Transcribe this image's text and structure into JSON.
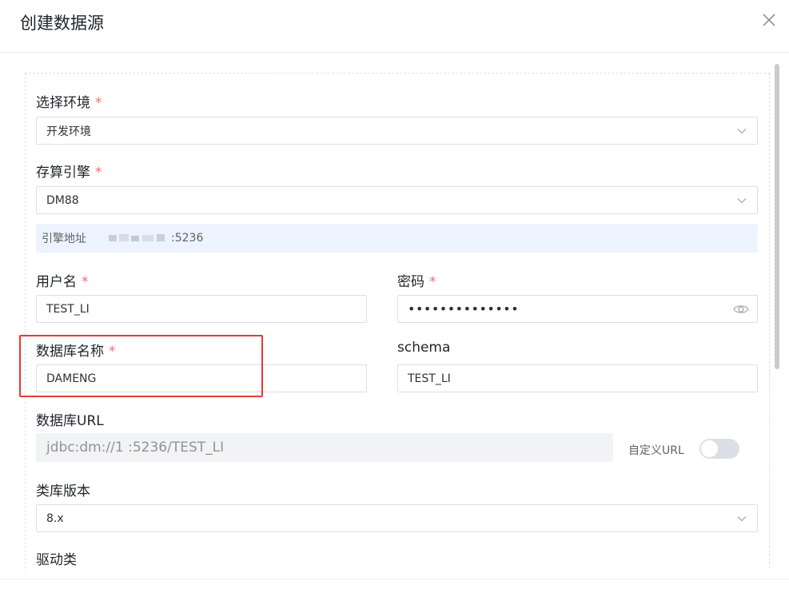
{
  "dialog": {
    "title": "创建数据源"
  },
  "form": {
    "environment": {
      "label": "选择环境",
      "required_mark": "*",
      "value": "开发环境"
    },
    "engine": {
      "label": "存算引擎",
      "required_mark": "*",
      "value": "DM88"
    },
    "engine_address": {
      "label": "引擎地址",
      "value": ":5236"
    },
    "username": {
      "label": "用户名",
      "required_mark": "*",
      "value": "TEST_LI"
    },
    "password": {
      "label": "密码",
      "required_mark": "*",
      "value": "••••••••••••••"
    },
    "database_name": {
      "label": "数据库名称",
      "required_mark": "*",
      "value": "DAMENG"
    },
    "schema": {
      "label": "schema",
      "value": "TEST_LI"
    },
    "database_url": {
      "label": "数据库URL",
      "value": "jdbc:dm://1          :5236/TEST_LI",
      "custom_url_label": "自定义URL",
      "custom_url_enabled": false
    },
    "library_version": {
      "label": "类库版本",
      "value": "8.x"
    },
    "driver_class": {
      "label": "驱动类"
    }
  },
  "icons": {
    "close": "close-icon",
    "arrow": "chevron-down-icon",
    "eye": "eye-icon"
  },
  "colors": {
    "required": "#f56c6c",
    "highlight": "#e53935",
    "info_bg": "#edf3ff"
  }
}
